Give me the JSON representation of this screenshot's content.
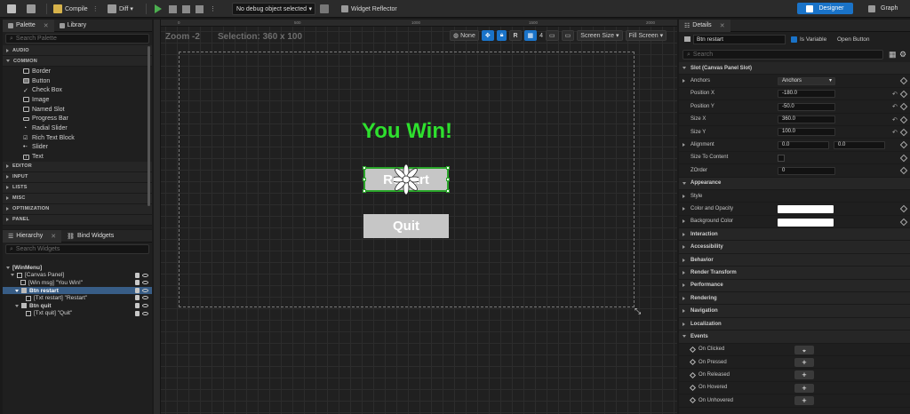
{
  "toolbar": {
    "compile_label": "Compile",
    "diff_label": "Diff",
    "debug_select": "No debug object selected",
    "widget_reflector": "Widget Reflector",
    "designer_label": "Designer",
    "graph_label": "Graph"
  },
  "palette": {
    "tab_palette": "Palette",
    "tab_library": "Library",
    "search_placeholder": "Search Palette",
    "categories": [
      "AUDIO",
      "COMMON",
      "EDITOR",
      "INPUT",
      "LISTS",
      "MISC",
      "OPTIMIZATION",
      "PANEL"
    ],
    "common_items": [
      "Border",
      "Button",
      "Check Box",
      "Image",
      "Named Slot",
      "Progress Bar",
      "Radial Slider",
      "Rich Text Block",
      "Slider",
      "Text"
    ]
  },
  "hierarchy": {
    "tab_hierarchy": "Hierarchy",
    "tab_bind": "Bind Widgets",
    "search_placeholder": "Search Widgets",
    "rows": [
      "[WinMenu]",
      "[Canvas Panel]",
      "[Win msg] \"You Win!\"",
      "Btn restart",
      "[Txt restart] \"Restart\"",
      "Btn quit",
      "[Txt quit] \"Quit\""
    ]
  },
  "viewport": {
    "zoom": "Zoom -2",
    "selection": "Selection: 360 x 100",
    "ruler_ticks": [
      "0",
      "500",
      "1000",
      "1500",
      "2000"
    ],
    "none_label": "None",
    "r_label": "R",
    "grid_value": "4",
    "screen_size": "Screen Size",
    "fill_screen": "Fill Screen",
    "win_text": "You Win!",
    "restart_text": "Restart",
    "quit_text": "Quit"
  },
  "details": {
    "tab": "Details",
    "name_value": "Btn restart",
    "is_variable": "Is Variable",
    "open_button": "Open Button",
    "search_placeholder": "Search",
    "slot_section": "Slot (Canvas Panel Slot)",
    "anchors_label": "Anchors",
    "anchors_value": "Anchors",
    "position_x_label": "Position X",
    "position_x": "-180.0",
    "position_y_label": "Position Y",
    "position_y": "-50.0",
    "size_x_label": "Size X",
    "size_x": "360.0",
    "size_y_label": "Size Y",
    "size_y": "100.0",
    "alignment_label": "Alignment",
    "alignment_x": "0.0",
    "alignment_y": "0.0",
    "size_to_content": "Size To Content",
    "zorder_label": "ZOrder",
    "zorder": "0",
    "appearance": "Appearance",
    "style": "Style",
    "color_opacity": "Color and Opacity",
    "background_color": "Background Color",
    "sections": [
      "Interaction",
      "Accessibility",
      "Behavior",
      "Render Transform",
      "Performance",
      "Rendering",
      "Navigation",
      "Localization"
    ],
    "events": "Events",
    "event_items": [
      "On Clicked",
      "On Pressed",
      "On Released",
      "On Hovered",
      "On Unhovered"
    ]
  }
}
